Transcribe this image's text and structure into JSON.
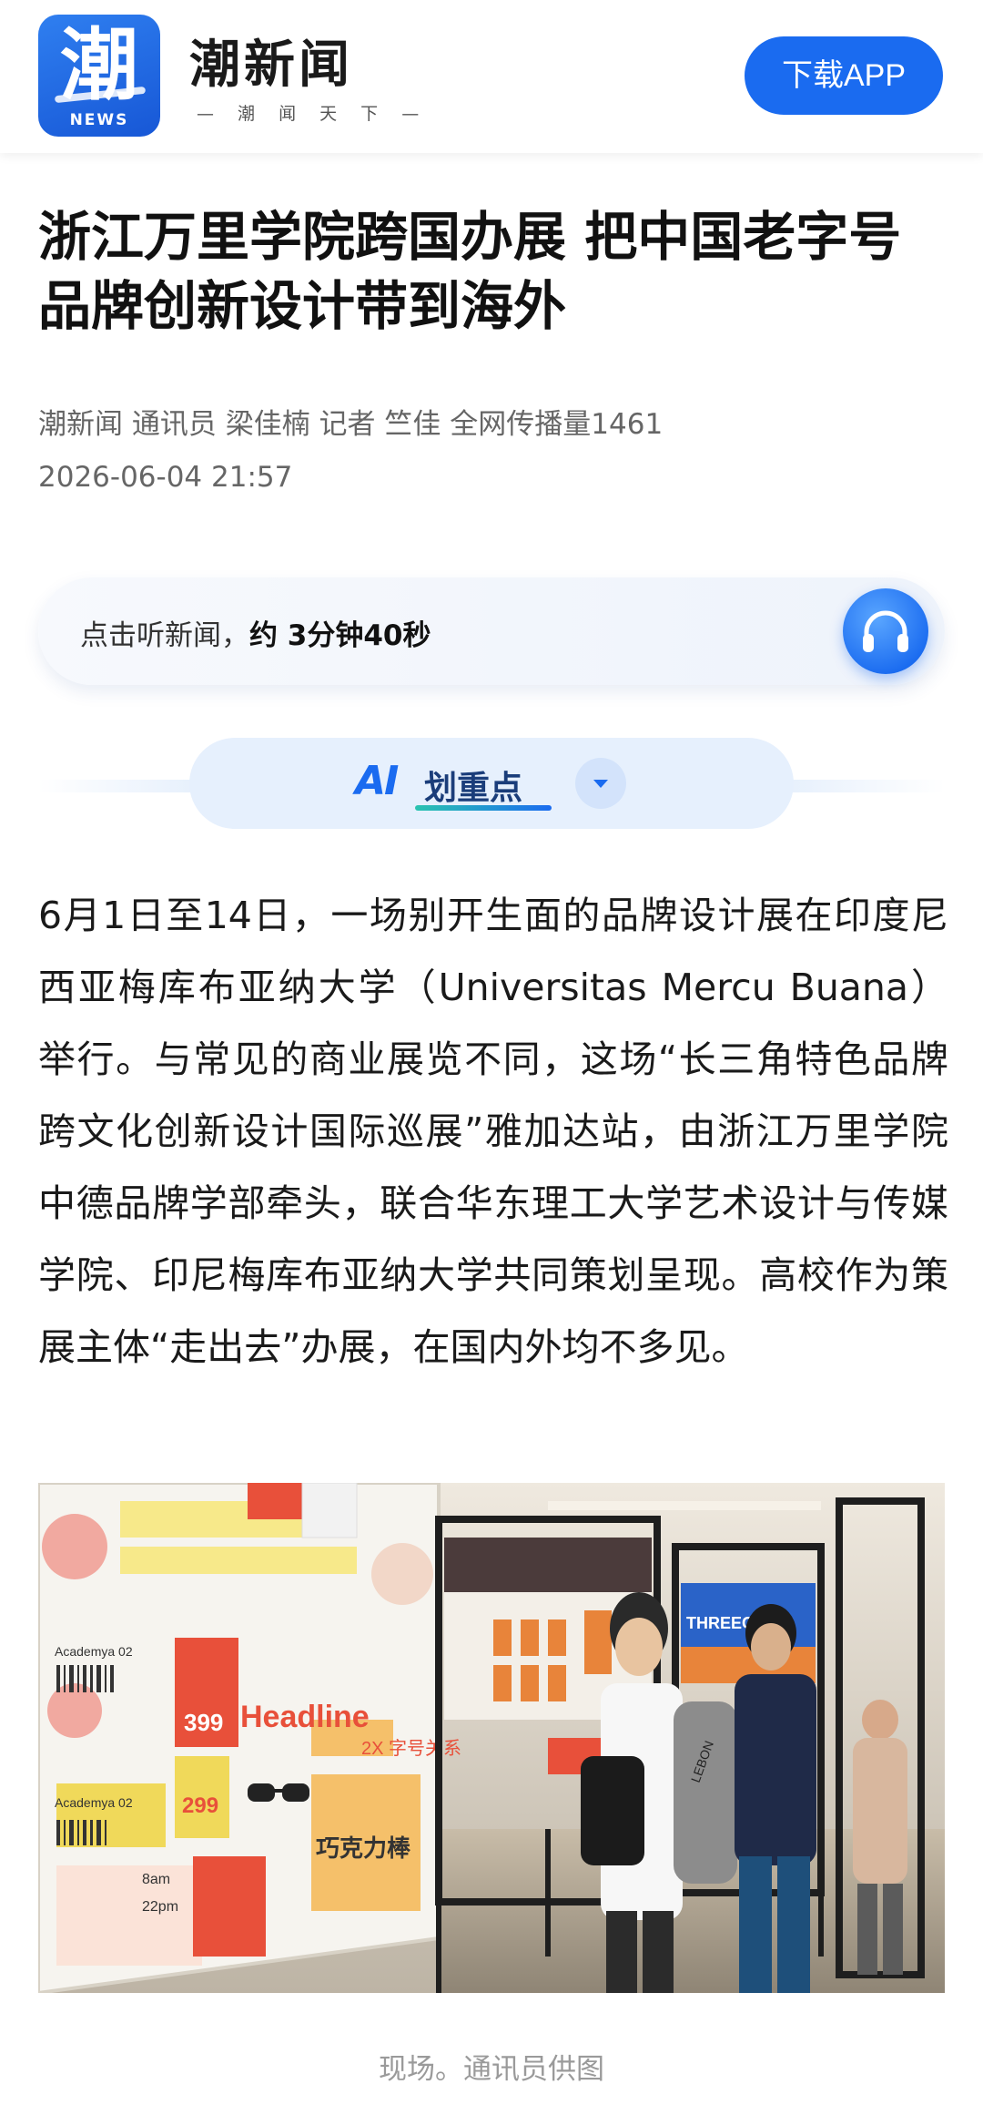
{
  "header": {
    "logo_glyph": "潮",
    "logo_sub": "NEWS",
    "brand_name": "潮新闻",
    "slogan": "— 潮 闻 天 下 —",
    "download_label": "下载APP"
  },
  "article": {
    "title": "浙江万里学院跨国办展 把中国老字号品牌创新设计带到海外",
    "byline": "潮新闻 通讯员 梁佳楠 记者 竺佳 全网传播量1461",
    "datetime": "2026-06-04 21:57",
    "paragraph": "6月1日至14日，一场别开生面的品牌设计展在印度尼西亚梅库布亚纳大学（Universitas Mercu Buana）举行。与常见的商业展览不同，这场“长三角特色品牌跨文化创新设计国际巡展”雅加达站，由浙江万里学院中德品牌学部牵头，联合华东理工大学艺术设计与传媒学院、印尼梅库布亚纳大学共同策划呈现。高校作为策展主体“走出去”办展，在国内外均不多见。",
    "photo_caption": "现场。通讯员供图"
  },
  "listen": {
    "prefix": "点击听新闻，",
    "duration": "约 3分钟40秒",
    "icon": "headphones-icon"
  },
  "ai_highlight": {
    "logo": "AI",
    "label": "划重点",
    "icon": "chevron-down-icon"
  },
  "photo_texts": {
    "headline": "Headline",
    "price_a": "399",
    "price_b": "299",
    "academy_a": "Academya 02",
    "academy_b": "Academya 02",
    "subhead": "2X 字号关系",
    "calligraphy": "巧克力棒",
    "time_a": "8am",
    "time_b": "22pm",
    "poster_sign": "THREEGUN",
    "bag_text": "LEBON"
  },
  "colors": {
    "brand_blue": "#1a6bf0",
    "text_dark": "#1a1a1a",
    "text_meta": "#666666",
    "caption": "#9a9a9a"
  }
}
